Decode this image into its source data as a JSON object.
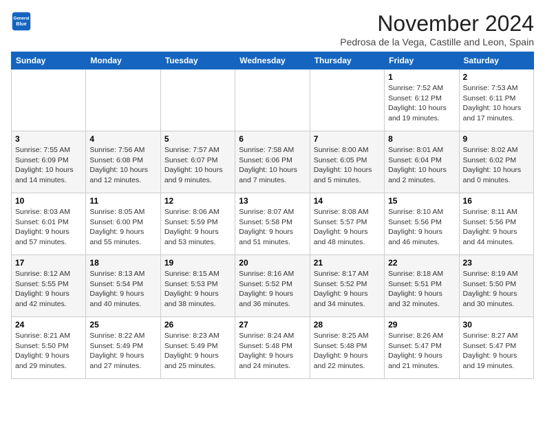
{
  "header": {
    "logo_line1": "General",
    "logo_line2": "Blue",
    "month": "November 2024",
    "location": "Pedrosa de la Vega, Castille and Leon, Spain"
  },
  "days_of_week": [
    "Sunday",
    "Monday",
    "Tuesday",
    "Wednesday",
    "Thursday",
    "Friday",
    "Saturday"
  ],
  "weeks": [
    [
      {
        "day": "",
        "info": ""
      },
      {
        "day": "",
        "info": ""
      },
      {
        "day": "",
        "info": ""
      },
      {
        "day": "",
        "info": ""
      },
      {
        "day": "",
        "info": ""
      },
      {
        "day": "1",
        "info": "Sunrise: 7:52 AM\nSunset: 6:12 PM\nDaylight: 10 hours and 19 minutes."
      },
      {
        "day": "2",
        "info": "Sunrise: 7:53 AM\nSunset: 6:11 PM\nDaylight: 10 hours and 17 minutes."
      }
    ],
    [
      {
        "day": "3",
        "info": "Sunrise: 7:55 AM\nSunset: 6:09 PM\nDaylight: 10 hours and 14 minutes."
      },
      {
        "day": "4",
        "info": "Sunrise: 7:56 AM\nSunset: 6:08 PM\nDaylight: 10 hours and 12 minutes."
      },
      {
        "day": "5",
        "info": "Sunrise: 7:57 AM\nSunset: 6:07 PM\nDaylight: 10 hours and 9 minutes."
      },
      {
        "day": "6",
        "info": "Sunrise: 7:58 AM\nSunset: 6:06 PM\nDaylight: 10 hours and 7 minutes."
      },
      {
        "day": "7",
        "info": "Sunrise: 8:00 AM\nSunset: 6:05 PM\nDaylight: 10 hours and 5 minutes."
      },
      {
        "day": "8",
        "info": "Sunrise: 8:01 AM\nSunset: 6:04 PM\nDaylight: 10 hours and 2 minutes."
      },
      {
        "day": "9",
        "info": "Sunrise: 8:02 AM\nSunset: 6:02 PM\nDaylight: 10 hours and 0 minutes."
      }
    ],
    [
      {
        "day": "10",
        "info": "Sunrise: 8:03 AM\nSunset: 6:01 PM\nDaylight: 9 hours and 57 minutes."
      },
      {
        "day": "11",
        "info": "Sunrise: 8:05 AM\nSunset: 6:00 PM\nDaylight: 9 hours and 55 minutes."
      },
      {
        "day": "12",
        "info": "Sunrise: 8:06 AM\nSunset: 5:59 PM\nDaylight: 9 hours and 53 minutes."
      },
      {
        "day": "13",
        "info": "Sunrise: 8:07 AM\nSunset: 5:58 PM\nDaylight: 9 hours and 51 minutes."
      },
      {
        "day": "14",
        "info": "Sunrise: 8:08 AM\nSunset: 5:57 PM\nDaylight: 9 hours and 48 minutes."
      },
      {
        "day": "15",
        "info": "Sunrise: 8:10 AM\nSunset: 5:56 PM\nDaylight: 9 hours and 46 minutes."
      },
      {
        "day": "16",
        "info": "Sunrise: 8:11 AM\nSunset: 5:56 PM\nDaylight: 9 hours and 44 minutes."
      }
    ],
    [
      {
        "day": "17",
        "info": "Sunrise: 8:12 AM\nSunset: 5:55 PM\nDaylight: 9 hours and 42 minutes."
      },
      {
        "day": "18",
        "info": "Sunrise: 8:13 AM\nSunset: 5:54 PM\nDaylight: 9 hours and 40 minutes."
      },
      {
        "day": "19",
        "info": "Sunrise: 8:15 AM\nSunset: 5:53 PM\nDaylight: 9 hours and 38 minutes."
      },
      {
        "day": "20",
        "info": "Sunrise: 8:16 AM\nSunset: 5:52 PM\nDaylight: 9 hours and 36 minutes."
      },
      {
        "day": "21",
        "info": "Sunrise: 8:17 AM\nSunset: 5:52 PM\nDaylight: 9 hours and 34 minutes."
      },
      {
        "day": "22",
        "info": "Sunrise: 8:18 AM\nSunset: 5:51 PM\nDaylight: 9 hours and 32 minutes."
      },
      {
        "day": "23",
        "info": "Sunrise: 8:19 AM\nSunset: 5:50 PM\nDaylight: 9 hours and 30 minutes."
      }
    ],
    [
      {
        "day": "24",
        "info": "Sunrise: 8:21 AM\nSunset: 5:50 PM\nDaylight: 9 hours and 29 minutes."
      },
      {
        "day": "25",
        "info": "Sunrise: 8:22 AM\nSunset: 5:49 PM\nDaylight: 9 hours and 27 minutes."
      },
      {
        "day": "26",
        "info": "Sunrise: 8:23 AM\nSunset: 5:49 PM\nDaylight: 9 hours and 25 minutes."
      },
      {
        "day": "27",
        "info": "Sunrise: 8:24 AM\nSunset: 5:48 PM\nDaylight: 9 hours and 24 minutes."
      },
      {
        "day": "28",
        "info": "Sunrise: 8:25 AM\nSunset: 5:48 PM\nDaylight: 9 hours and 22 minutes."
      },
      {
        "day": "29",
        "info": "Sunrise: 8:26 AM\nSunset: 5:47 PM\nDaylight: 9 hours and 21 minutes."
      },
      {
        "day": "30",
        "info": "Sunrise: 8:27 AM\nSunset: 5:47 PM\nDaylight: 9 hours and 19 minutes."
      }
    ]
  ]
}
